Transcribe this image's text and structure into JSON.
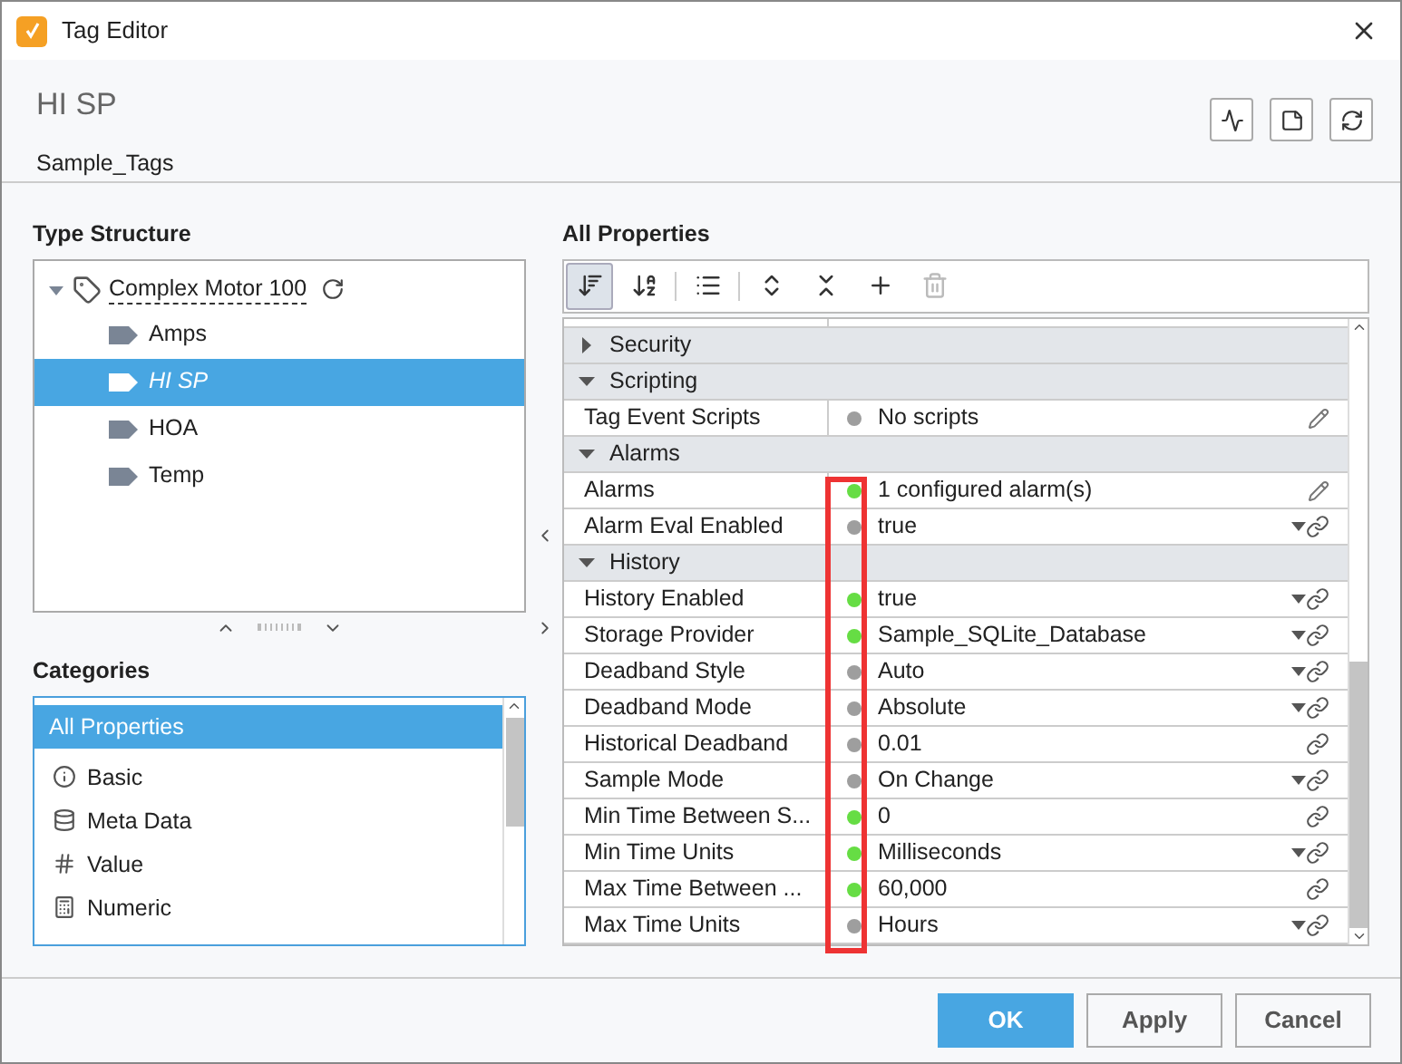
{
  "window": {
    "title": "Tag Editor"
  },
  "header": {
    "title": "HI SP",
    "subtitle": "Sample_Tags"
  },
  "type_structure": {
    "title": "Type Structure",
    "root": {
      "label": "Complex Motor 100",
      "expanded": true,
      "children": [
        {
          "label": "Amps",
          "selected": false,
          "italic": false
        },
        {
          "label": "HI SP",
          "selected": true,
          "italic": true
        },
        {
          "label": "HOA",
          "selected": false,
          "italic": false
        },
        {
          "label": "Temp",
          "selected": false,
          "italic": false
        }
      ]
    }
  },
  "categories": {
    "title": "Categories",
    "items": [
      {
        "label": "All Properties",
        "kind": "all",
        "selected": true
      },
      {
        "label": "Basic",
        "kind": "info",
        "selected": false
      },
      {
        "label": "Meta Data",
        "kind": "database",
        "selected": false
      },
      {
        "label": "Value",
        "kind": "value",
        "selected": false
      },
      {
        "label": "Numeric",
        "kind": "calculator",
        "selected": false
      }
    ]
  },
  "properties": {
    "title": "All Properties",
    "toolbar": [
      {
        "kind": "sort_category",
        "selected": true,
        "disabled": false
      },
      {
        "kind": "sort_alpha",
        "selected": false,
        "disabled": false
      },
      {
        "kind": "list",
        "selected": false,
        "disabled": false
      },
      {
        "kind": "expand",
        "selected": false,
        "disabled": false
      },
      {
        "kind": "collapse",
        "selected": false,
        "disabled": false
      },
      {
        "kind": "add",
        "selected": false,
        "disabled": false
      },
      {
        "kind": "delete",
        "selected": false,
        "disabled": true
      }
    ],
    "rows": [
      {
        "kind": "group",
        "name": "Security",
        "expanded": false
      },
      {
        "kind": "group",
        "name": "Scripting",
        "expanded": true
      },
      {
        "kind": "property",
        "name": "Tag Event Scripts",
        "color": "#9e9e9e",
        "value": "No scripts",
        "editable": true,
        "dropdown": false,
        "bindable": false
      },
      {
        "kind": "group",
        "name": "Alarms",
        "expanded": true
      },
      {
        "kind": "property",
        "name": "Alarms",
        "color": "#66dd44",
        "value": "1 configured alarm(s)",
        "editable": true,
        "dropdown": false,
        "bindable": false
      },
      {
        "kind": "property",
        "name": "Alarm Eval Enabled",
        "color": "#9e9e9e",
        "value": "true",
        "editable": false,
        "dropdown": true,
        "bindable": true
      },
      {
        "kind": "group",
        "name": "History",
        "expanded": true
      },
      {
        "kind": "property",
        "name": "History Enabled",
        "color": "#66dd44",
        "value": "true",
        "editable": false,
        "dropdown": true,
        "bindable": true
      },
      {
        "kind": "property",
        "name": "Storage Provider",
        "color": "#66dd44",
        "value": "Sample_SQLite_Database",
        "editable": false,
        "dropdown": true,
        "bindable": true
      },
      {
        "kind": "property",
        "name": "Deadband Style",
        "color": "#9e9e9e",
        "value": "Auto",
        "editable": false,
        "dropdown": true,
        "bindable": true
      },
      {
        "kind": "property",
        "name": "Deadband Mode",
        "color": "#9e9e9e",
        "value": "Absolute",
        "editable": false,
        "dropdown": true,
        "bindable": true
      },
      {
        "kind": "property",
        "name": "Historical Deadband",
        "color": "#9e9e9e",
        "value": "0.01",
        "editable": false,
        "dropdown": false,
        "bindable": true
      },
      {
        "kind": "property",
        "name": "Sample Mode",
        "color": "#9e9e9e",
        "value": "On Change",
        "editable": false,
        "dropdown": true,
        "bindable": true
      },
      {
        "kind": "property",
        "name": "Min Time Between S...",
        "color": "#66dd44",
        "value": "0",
        "editable": false,
        "dropdown": false,
        "bindable": true
      },
      {
        "kind": "property",
        "name": "Min Time Units",
        "color": "#66dd44",
        "value": "Milliseconds",
        "editable": false,
        "dropdown": true,
        "bindable": true
      },
      {
        "kind": "property",
        "name": "Max Time Between ...",
        "color": "#66dd44",
        "value": "60,000",
        "editable": false,
        "dropdown": false,
        "bindable": true
      },
      {
        "kind": "property",
        "name": "Max Time Units",
        "color": "#9e9e9e",
        "value": "Hours",
        "editable": false,
        "dropdown": true,
        "bindable": true
      }
    ]
  },
  "buttons": [
    {
      "label": "OK",
      "kind": "primary"
    },
    {
      "label": "Apply",
      "kind": "secondary"
    },
    {
      "label": "Cancel",
      "kind": "secondary"
    }
  ]
}
